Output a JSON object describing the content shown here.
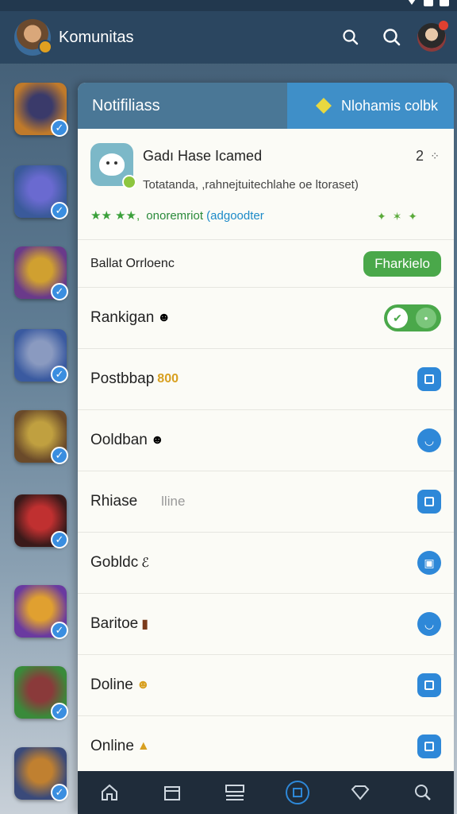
{
  "app_bar": {
    "title": "Komunitas"
  },
  "side_list": {
    "items": [
      {
        "colors": [
          "#c07a2a",
          "#3a3a6a"
        ]
      },
      {
        "colors": [
          "#3a5a9a",
          "#6a6ad0"
        ]
      },
      {
        "colors": [
          "#6a3a8a",
          "#d0a030"
        ]
      },
      {
        "colors": [
          "#3a5aa0",
          "#8a9ac0"
        ]
      },
      {
        "colors": [
          "#6a4a2a",
          "#c0a040"
        ]
      },
      {
        "colors": [
          "#3a1a1a",
          "#c03030"
        ]
      },
      {
        "colors": [
          "#6a3aa0",
          "#e0a030"
        ]
      },
      {
        "colors": [
          "#3a8a3a",
          "#8a3a3a"
        ]
      },
      {
        "colors": [
          "#3a4a7a",
          "#c08030"
        ]
      }
    ]
  },
  "panel": {
    "title": "Notifiliass",
    "action_label": "Nlohamis colbk",
    "notification": {
      "title": "Gadı Hase Icamed",
      "count": "2",
      "body": "Totatanda, ,rahnejtuitechlahe oe ltoraset)",
      "stars": "★★ ★★,",
      "org": "onoremriot",
      "meta": "(adgoodter",
      "spark": "✦ ✶ ✦"
    },
    "rows": [
      {
        "label": "Ballat Orrloenc",
        "control": "pill",
        "control_label": "Fharkielo"
      },
      {
        "label": "Rankigan",
        "emoji": "☻",
        "control": "toggle"
      },
      {
        "label": "Postbbap",
        "emoji": "800",
        "control": "square"
      },
      {
        "label": "Ooldban",
        "emoji": "☻",
        "control": "circle"
      },
      {
        "label": "Rhiase",
        "sub": "lline",
        "control": "square"
      },
      {
        "label": "Gobldc",
        "emoji": "ℰ",
        "control": "circle"
      },
      {
        "label": "Baritoe",
        "emoji": "▮",
        "control": "circle"
      },
      {
        "label": "Doline",
        "emoji": "☻",
        "control": "square"
      },
      {
        "label": "Online",
        "emoji": "▲",
        "control": "square"
      }
    ]
  },
  "colors": {
    "app_bar": "#2b4660",
    "panel_header": "#4a7796",
    "accent_blue": "#2e88d8",
    "accent_green": "#4aa84a"
  }
}
